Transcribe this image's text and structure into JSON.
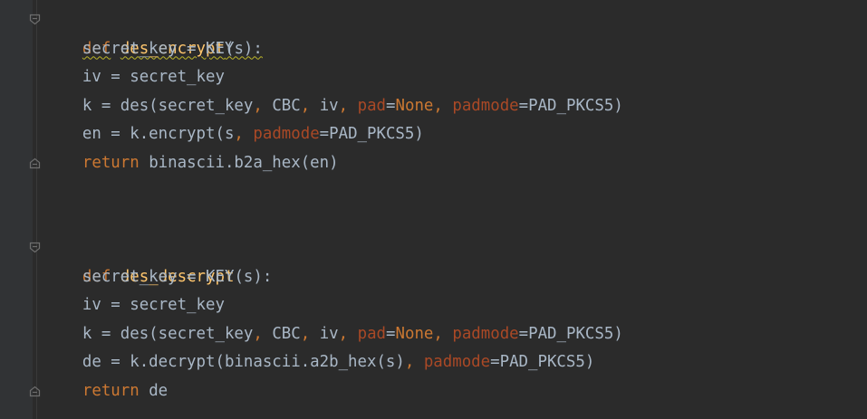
{
  "code": {
    "func1": {
      "def_kw": "def",
      "name": "des_encrypt",
      "sig_rest": "(s):",
      "l1": "secret_key = KEY",
      "l2": "iv = secret_key",
      "l3a": "k = des(secret_key",
      "l3b": ", ",
      "l3c": "CBC",
      "l3d": ", ",
      "l3e": "iv",
      "l3f": ", ",
      "l3g": "pad",
      "l3h": "=",
      "l3i": "None",
      "l3j": ", ",
      "l3k": "padmode",
      "l3l": "=PAD_PKCS5)",
      "l4a": "en = k.encrypt(s",
      "l4b": ", ",
      "l4c": "padmode",
      "l4d": "=PAD_PKCS5)",
      "l5_kw": "return",
      "l5_rest": " binascii.b2a_hex(en)"
    },
    "func2": {
      "def_kw": "def",
      "name": "des_descrypt",
      "sig_rest": "(s):",
      "l1": "secret_key = KEY",
      "l2": "iv = secret_key",
      "l3a": "k = des(secret_key",
      "l3b": ", ",
      "l3c": "CBC",
      "l3d": ", ",
      "l3e": "iv",
      "l3f": ", ",
      "l3g": "pad",
      "l3h": "=",
      "l3i": "None",
      "l3j": ", ",
      "l3k": "padmode",
      "l3l": "=PAD_PKCS5)",
      "l4a": "de = k.decrypt(binascii.a2b_hex(s)",
      "l4b": ", ",
      "l4c": "padmode",
      "l4d": "=PAD_PKCS5)",
      "l5_kw": "return",
      "l5_rest": " de"
    }
  },
  "colors": {
    "background": "#2b2b2b",
    "keyword": "#cc7832",
    "function_name": "#ffc66d",
    "named_param": "#aa4926",
    "default_text": "#a9b7c6"
  },
  "icons": [
    "fold-open-icon",
    "fold-close-icon"
  ]
}
